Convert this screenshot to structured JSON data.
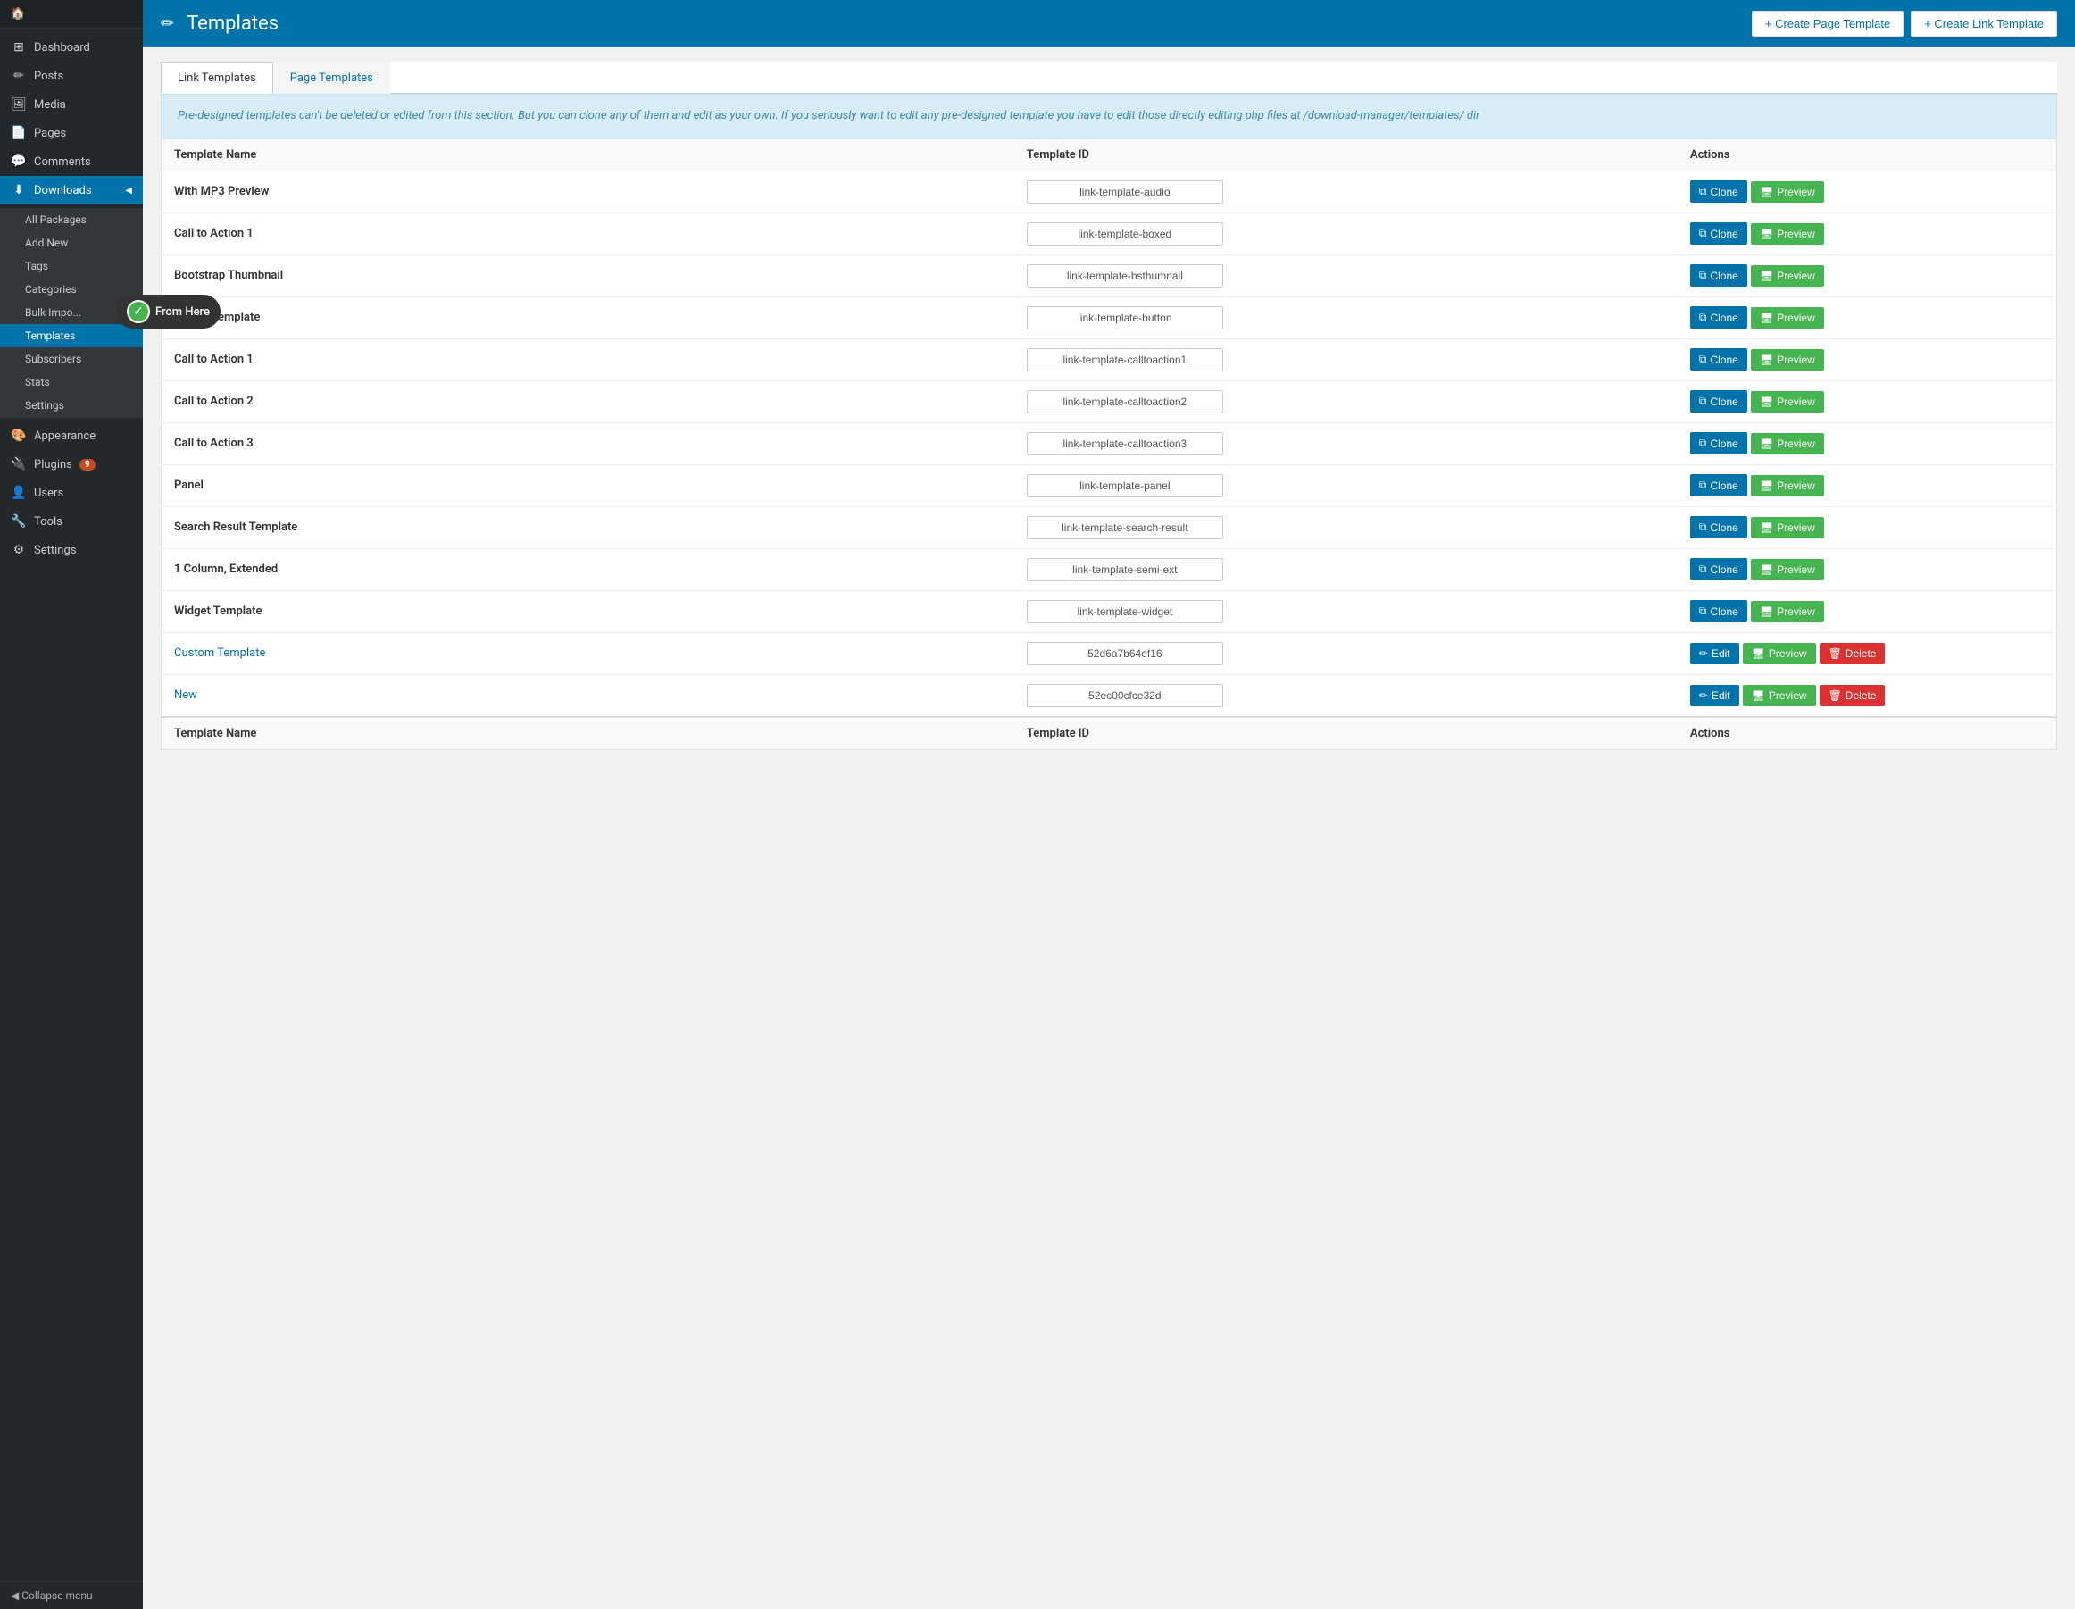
{
  "sidebar": {
    "logo": "🏠",
    "items": [
      {
        "id": "dashboard",
        "label": "Dashboard",
        "icon": "⊞"
      },
      {
        "id": "posts",
        "label": "Posts",
        "icon": "✏"
      },
      {
        "id": "media",
        "label": "Media",
        "icon": "🖼"
      },
      {
        "id": "pages",
        "label": "Pages",
        "icon": "📄"
      },
      {
        "id": "comments",
        "label": "Comments",
        "icon": "💬"
      },
      {
        "id": "downloads",
        "label": "Downloads",
        "icon": "⬇",
        "active": true
      },
      {
        "id": "appearance",
        "label": "Appearance",
        "icon": "🎨"
      },
      {
        "id": "plugins",
        "label": "Plugins",
        "icon": "🔌",
        "badge": "9"
      },
      {
        "id": "users",
        "label": "Users",
        "icon": "👤"
      },
      {
        "id": "tools",
        "label": "Tools",
        "icon": "🔧"
      },
      {
        "id": "settings",
        "label": "Settings",
        "icon": "⚙"
      }
    ],
    "submenu": [
      {
        "id": "all-packages",
        "label": "All Packages"
      },
      {
        "id": "add-new",
        "label": "Add New"
      },
      {
        "id": "tags",
        "label": "Tags"
      },
      {
        "id": "categories",
        "label": "Categories"
      },
      {
        "id": "bulk-import",
        "label": "Bulk Impo..."
      },
      {
        "id": "templates",
        "label": "Templates",
        "active": true
      },
      {
        "id": "subscribers",
        "label": "Subscribers"
      },
      {
        "id": "stats",
        "label": "Stats"
      },
      {
        "id": "settings-sub",
        "label": "Settings"
      }
    ],
    "collapse_label": "Collapse menu"
  },
  "header": {
    "icon": "✏",
    "title": "Templates",
    "create_page_btn": "+ Create Page Template",
    "create_link_btn": "+ Create Link Template"
  },
  "tabs": [
    {
      "id": "link-templates",
      "label": "Link Templates",
      "active": true
    },
    {
      "id": "page-templates",
      "label": "Page Templates",
      "active": false
    }
  ],
  "info_message": "Pre-designed templates can't be deleted or edited from this section. But you can clone any of them and edit as your own. If you seriously want to edit any pre-designed template you have to edit those directly editing php files at /download-manager/templates/ dir",
  "table": {
    "columns": [
      {
        "id": "name",
        "label": "Template Name"
      },
      {
        "id": "id",
        "label": "Template ID"
      },
      {
        "id": "actions",
        "label": "Actions"
      }
    ],
    "rows": [
      {
        "name": "With MP3 Preview",
        "template_id": "link-template-audio",
        "type": "predesigned"
      },
      {
        "name": "Call to Action 1",
        "template_id": "link-template-boxed",
        "type": "predesigned"
      },
      {
        "name": "Bootstrap Thumbnail",
        "template_id": "link-template-bsthumnail",
        "type": "predesigned"
      },
      {
        "name": "Button Template",
        "template_id": "link-template-button",
        "type": "predesigned"
      },
      {
        "name": "Call to Action 1",
        "template_id": "link-template-calltoaction1",
        "type": "predesigned"
      },
      {
        "name": "Call to Action 2",
        "template_id": "link-template-calltoaction2",
        "type": "predesigned"
      },
      {
        "name": "Call to Action 3",
        "template_id": "link-template-calltoaction3",
        "type": "predesigned"
      },
      {
        "name": "Panel",
        "template_id": "link-template-panel",
        "type": "predesigned"
      },
      {
        "name": "Search Result Template",
        "template_id": "link-template-search-result",
        "type": "predesigned"
      },
      {
        "name": "1 Column, Extended",
        "template_id": "link-template-semi-ext",
        "type": "predesigned"
      },
      {
        "name": "Widget Template",
        "template_id": "link-template-widget",
        "type": "predesigned"
      },
      {
        "name": "Custom Template",
        "template_id": "52d6a7b64ef16",
        "type": "custom"
      },
      {
        "name": "New",
        "template_id": "52ec00cfce32d",
        "type": "custom"
      }
    ],
    "footer_columns": [
      {
        "id": "name",
        "label": "Template Name"
      },
      {
        "id": "id",
        "label": "Template ID"
      },
      {
        "id": "actions",
        "label": "Actions"
      }
    ]
  },
  "from_here": {
    "label": "From Here",
    "check_icon": "✓"
  },
  "buttons": {
    "clone": "Clone",
    "preview": "Preview",
    "edit": "Edit",
    "delete": "Delete"
  }
}
